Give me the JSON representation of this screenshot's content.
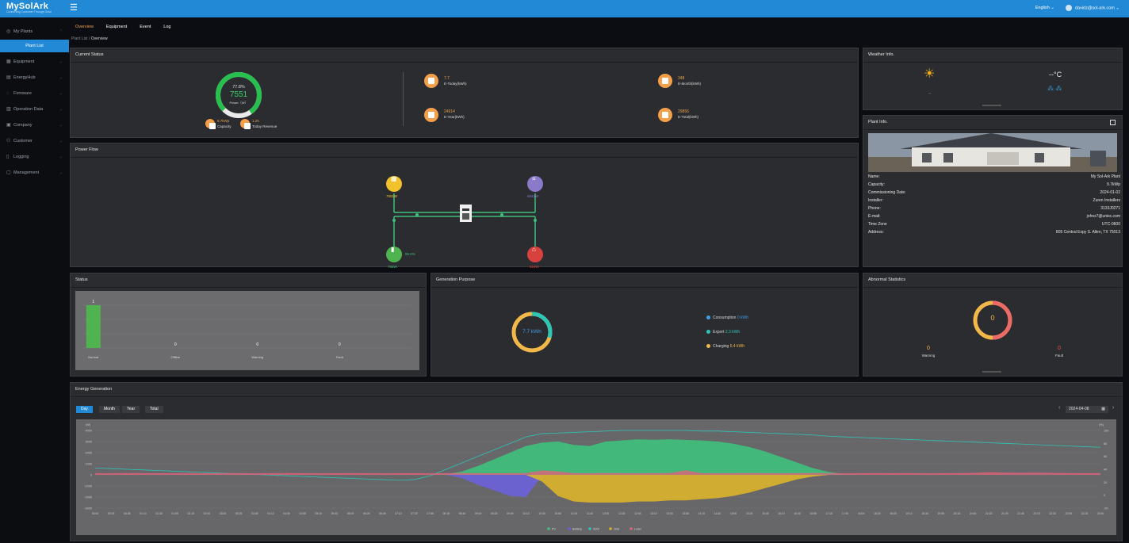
{
  "header": {
    "logo": "MySolArk",
    "tagline": "Connecting Customer Through Solar",
    "language": "English",
    "user": "davidz@sol-ark.com"
  },
  "sidebar": {
    "items": [
      {
        "label": "My Plants",
        "icon": "globe-icon"
      },
      {
        "label": "Plant List",
        "icon": ""
      },
      {
        "label": "Equipment",
        "icon": "grid-icon"
      },
      {
        "label": "EnergyHub",
        "icon": "hub-icon"
      },
      {
        "label": "Firmware",
        "icon": "chip-icon"
      },
      {
        "label": "Operation Data",
        "icon": "table-icon"
      },
      {
        "label": "Company",
        "icon": "building-icon"
      },
      {
        "label": "Customer",
        "icon": "users-icon"
      },
      {
        "label": "Logging",
        "icon": "doc-icon"
      },
      {
        "label": "Management",
        "icon": "settings-icon"
      }
    ]
  },
  "tabs": [
    "Overview",
    "Equipment",
    "Event",
    "Log"
  ],
  "breadcrumb": {
    "parent": "Plant List",
    "sep": "/",
    "current": "Overview"
  },
  "current_status": {
    "title": "Current Status",
    "gauge_percent": "77.8%",
    "power_value": "7551",
    "power_label": "Power（W）",
    "capacity_value": "9.7kWp",
    "capacity_label": "Capacity",
    "revenue_value": "1.25",
    "revenue_label": "Today Revenue",
    "stats": [
      {
        "value": "7.7",
        "label": "E-Today(kWh)"
      },
      {
        "value": "348",
        "label": "E-Month(kWh)"
      },
      {
        "value": "24914",
        "label": "E-Year(kWh)"
      },
      {
        "value": "29856",
        "label": "E-Total(kWh)"
      }
    ]
  },
  "weather": {
    "title": "Weather Info.",
    "temp": "--°C",
    "desc": "--"
  },
  "plant_info": {
    "title": "Plant Info.",
    "fields": [
      {
        "k": "Name:",
        "v": "My Sol-Ark Plant"
      },
      {
        "k": "Capacity:",
        "v": "9.7kWp"
      },
      {
        "k": "Commissioning Date:",
        "v": "2024-01-02"
      },
      {
        "k": "Installer:",
        "v": "Zuren Installers"
      },
      {
        "k": "Phone:",
        "v": "3133J0271"
      },
      {
        "k": "E-mail:",
        "v": "johnz7@unisc.com"
      },
      {
        "k": "Time Zone",
        "v": "UTC-0600"
      },
      {
        "k": "Address:",
        "v": "805 Central Expy S. Allen, TX 75013"
      }
    ]
  },
  "power_flow": {
    "title": "Power Flow",
    "pv": "7551W",
    "grid": "6842W",
    "battery": "758W",
    "battery_soc": "95.0%",
    "load": "516W"
  },
  "status": {
    "title": "Status",
    "categories": [
      "Normal",
      "Offline",
      "Warning",
      "Fault"
    ],
    "values": [
      1,
      0,
      0,
      0
    ],
    "colors": {
      "bar": "#4fb34f"
    }
  },
  "generation_purpose": {
    "title": "Generation Purpose",
    "total": "7.7 kWh",
    "items": [
      {
        "label": "Consumption",
        "value": "0 kWh",
        "color": "#3ba0e8"
      },
      {
        "label": "Export",
        "value": "2.3 kWh",
        "color": "#2ec4b6"
      },
      {
        "label": "Charging",
        "value": "5.4 kWh",
        "color": "#f2b94a"
      }
    ]
  },
  "abnormal": {
    "title": "Abnormal Statistics",
    "center": "0",
    "warning_value": "0",
    "warning_label": "Warning",
    "fault_value": "0",
    "fault_label": "Fault"
  },
  "energy_generation": {
    "title": "Energy Generation",
    "ranges": [
      "Day",
      "Month",
      "Year",
      "Total"
    ],
    "date": "2024-04-08",
    "left_unit": "(W)",
    "right_unit": "(%)"
  },
  "chart_data": {
    "type": "area",
    "title": "Energy Generation",
    "xlabel": "",
    "ylabel": "(W)",
    "y2label": "(%)",
    "ylim": [
      -3000,
      4000
    ],
    "ylim2": [
      -20,
      100
    ],
    "y_ticks": [
      "4000",
      "3000",
      "2000",
      "1000",
      "0",
      "-1000",
      "-2000",
      "-3000"
    ],
    "y2_ticks": [
      "100",
      "80",
      "60",
      "40",
      "20",
      "0",
      "-20"
    ],
    "x": [
      "00:00",
      "00:25",
      "00:45",
      "01:10",
      "01:30",
      "01:55",
      "02:15",
      "02:40",
      "03:00",
      "03:25",
      "03:45",
      "04:10",
      "04:30",
      "04:55",
      "05:15",
      "05:40",
      "06:00",
      "06:25",
      "06:45",
      "07:10",
      "07:30",
      "07:55",
      "08:15",
      "08:40",
      "09:00",
      "09:25",
      "09:45",
      "10:10",
      "10:30",
      "10:55",
      "11:15",
      "11:40",
      "12:00",
      "12:25",
      "12:45",
      "13:10",
      "13:30",
      "13:55",
      "14:15",
      "14:40",
      "15:00",
      "15:25",
      "15:45",
      "16:10",
      "16:30",
      "16:55",
      "17:15",
      "17:40",
      "18:00",
      "18:25",
      "18:45",
      "19:10",
      "19:30",
      "19:55",
      "20:15",
      "20:40",
      "21:00",
      "21:25",
      "21:45",
      "22:10",
      "22:30",
      "22:55",
      "23:15",
      "23:40"
    ],
    "series": [
      {
        "name": "PV",
        "color": "#3fc07c",
        "values": [
          0,
          0,
          0,
          0,
          0,
          0,
          0,
          0,
          0,
          0,
          0,
          0,
          0,
          0,
          0,
          0,
          0,
          0,
          0,
          0,
          0,
          0,
          50,
          300,
          800,
          1400,
          2000,
          2600,
          2900,
          3000,
          2700,
          2600,
          3000,
          3100,
          3200,
          3150,
          3200,
          3150,
          3100,
          3000,
          2800,
          2500,
          2100,
          1600,
          1100,
          600,
          250,
          50,
          0,
          0,
          0,
          0,
          0,
          0,
          0,
          0,
          0,
          0,
          0,
          0,
          0,
          0,
          0,
          0
        ]
      },
      {
        "name": "Battery",
        "color": "#6b62d9",
        "values": [
          0,
          0,
          0,
          0,
          0,
          0,
          0,
          0,
          0,
          0,
          0,
          0,
          0,
          0,
          0,
          0,
          0,
          0,
          0,
          0,
          0,
          0,
          0,
          -300,
          -900,
          -1400,
          -1900,
          -2000,
          -100,
          0,
          0,
          0,
          0,
          0,
          0,
          0,
          0,
          0,
          0,
          0,
          0,
          0,
          0,
          0,
          0,
          0,
          0,
          0,
          0,
          0,
          0,
          0,
          0,
          0,
          0,
          0,
          0,
          0,
          0,
          0,
          0,
          0,
          0,
          0
        ]
      },
      {
        "name": "SOC",
        "color": "#2ec4b6",
        "values": [
          42,
          41,
          40,
          39,
          38,
          37,
          36,
          35,
          34,
          33,
          32,
          31,
          30,
          29,
          28,
          27,
          26,
          25,
          24,
          23,
          24,
          30,
          40,
          50,
          60,
          70,
          80,
          90,
          95,
          96,
          97,
          98,
          99,
          100,
          100,
          100,
          100,
          100,
          99,
          99,
          98,
          97,
          96,
          95,
          94,
          93,
          91,
          90,
          89,
          88,
          87,
          86,
          85,
          84,
          83,
          82,
          81,
          80,
          79,
          78,
          77,
          76,
          75,
          74
        ]
      },
      {
        "name": "Grid",
        "color": "#d9b22c",
        "values": [
          0,
          0,
          0,
          0,
          0,
          0,
          0,
          0,
          0,
          0,
          0,
          0,
          0,
          0,
          0,
          0,
          0,
          0,
          0,
          0,
          0,
          0,
          0,
          0,
          0,
          0,
          0,
          0,
          -600,
          -1900,
          -2400,
          -2500,
          -2500,
          -2500,
          -2400,
          -2400,
          -2300,
          -2300,
          -2200,
          -2100,
          -1900,
          -1600,
          -1200,
          -800,
          -400,
          -150,
          0,
          0,
          0,
          0,
          0,
          0,
          0,
          0,
          0,
          0,
          0,
          0,
          0,
          0,
          0,
          0,
          0,
          0
        ]
      },
      {
        "name": "Load",
        "color": "#e0627a",
        "values": [
          150,
          140,
          160,
          150,
          140,
          150,
          160,
          140,
          150,
          150,
          140,
          150,
          160,
          150,
          140,
          150,
          160,
          150,
          140,
          150,
          150,
          140,
          150,
          160,
          150,
          140,
          150,
          160,
          400,
          300,
          150,
          140,
          160,
          150,
          140,
          150,
          160,
          400,
          150,
          140,
          150,
          160,
          150,
          140,
          150,
          160,
          150,
          140,
          150,
          160,
          150,
          160,
          140,
          150,
          160,
          170,
          230,
          200,
          180,
          200,
          170,
          160,
          150,
          150
        ]
      }
    ]
  }
}
